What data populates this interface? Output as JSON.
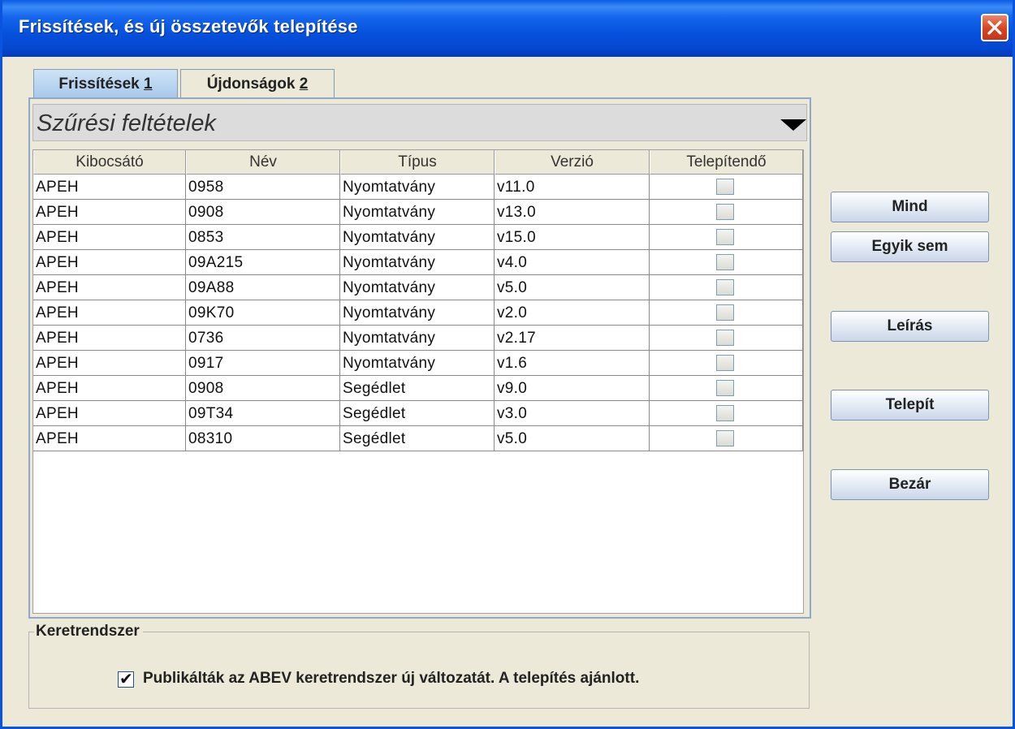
{
  "window": {
    "title": "Frissítések, és új összetevők telepítése",
    "close_icon": "close-icon"
  },
  "tabs": [
    {
      "label": "Frissítések ",
      "mnemonic": "1",
      "active": true
    },
    {
      "label": "Újdonságok ",
      "mnemonic": "2",
      "active": false
    }
  ],
  "filter": {
    "label": "Szűrési feltételek"
  },
  "table": {
    "columns": [
      "Kibocsátó",
      "Név",
      "Típus",
      "Verzió",
      "Telepítendő"
    ],
    "rows": [
      [
        "APEH",
        "0958",
        "Nyomtatvány",
        "v11.0",
        false
      ],
      [
        "APEH",
        "0908",
        "Nyomtatvány",
        "v13.0",
        false
      ],
      [
        "APEH",
        "0853",
        "Nyomtatvány",
        "v15.0",
        false
      ],
      [
        "APEH",
        "09A215",
        "Nyomtatvány",
        "v4.0",
        false
      ],
      [
        "APEH",
        "09A88",
        "Nyomtatvány",
        "v5.0",
        false
      ],
      [
        "APEH",
        "09K70",
        "Nyomtatvány",
        "v2.0",
        false
      ],
      [
        "APEH",
        "0736",
        "Nyomtatvány",
        "v2.17",
        false
      ],
      [
        "APEH",
        "0917",
        "Nyomtatvány",
        "v1.6",
        false
      ],
      [
        "APEH",
        "0908",
        "Segédlet",
        "v9.0",
        false
      ],
      [
        "APEH",
        "09T34",
        "Segédlet",
        "v3.0",
        false
      ],
      [
        "APEH",
        "08310",
        "Segédlet",
        "v5.0",
        false
      ]
    ]
  },
  "buttons": {
    "all": "Mind",
    "none": "Egyik sem",
    "description": "Leírás",
    "install": "Telepít",
    "close": "Bezár"
  },
  "framework": {
    "legend": "Keretrendszer",
    "checkbox_label": "Publikálták az ABEV keretrendszer új változatát. A telepítés ajánlott.",
    "checked": true
  }
}
